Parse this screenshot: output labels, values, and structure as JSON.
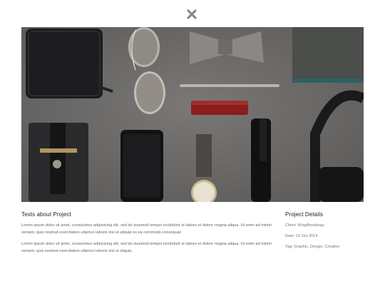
{
  "close_icon": "close-icon",
  "project": {
    "texts_title": "Texts about Project",
    "paragraph1": "Lorem ipsum dolor sit amet, consectetur adipisicing elit, sed do eiusmod tempor incididunt ut labore et dolore magna aliqua. Ut enim ad minim veniam, quis nostrud exercitation ullamco laboris nisi ut aliquip ex ea commodo consequat.",
    "paragraph2": "Lorem ipsum dolor sit amet, consectetur adipisicing elit, sed do eiusmod tempor incididunt ut labore et dolore magna aliqua. Ut enim ad minim veniam, quis nostrud exercitation ullamco laboris nisi ut aliquip."
  },
  "details": {
    "title": "Project Details",
    "client": "Client: WrapBootstrap",
    "date": "Date: 15 Oct 2014",
    "tag_prefix": "Tag: ",
    "tags": [
      "Graphic",
      "Design",
      "Creative"
    ],
    "tag_separator": ", "
  },
  "colors": {
    "background": "#ffffff",
    "photo_bg": "#6d6b69",
    "heading": "#222222",
    "text": "#666666"
  }
}
